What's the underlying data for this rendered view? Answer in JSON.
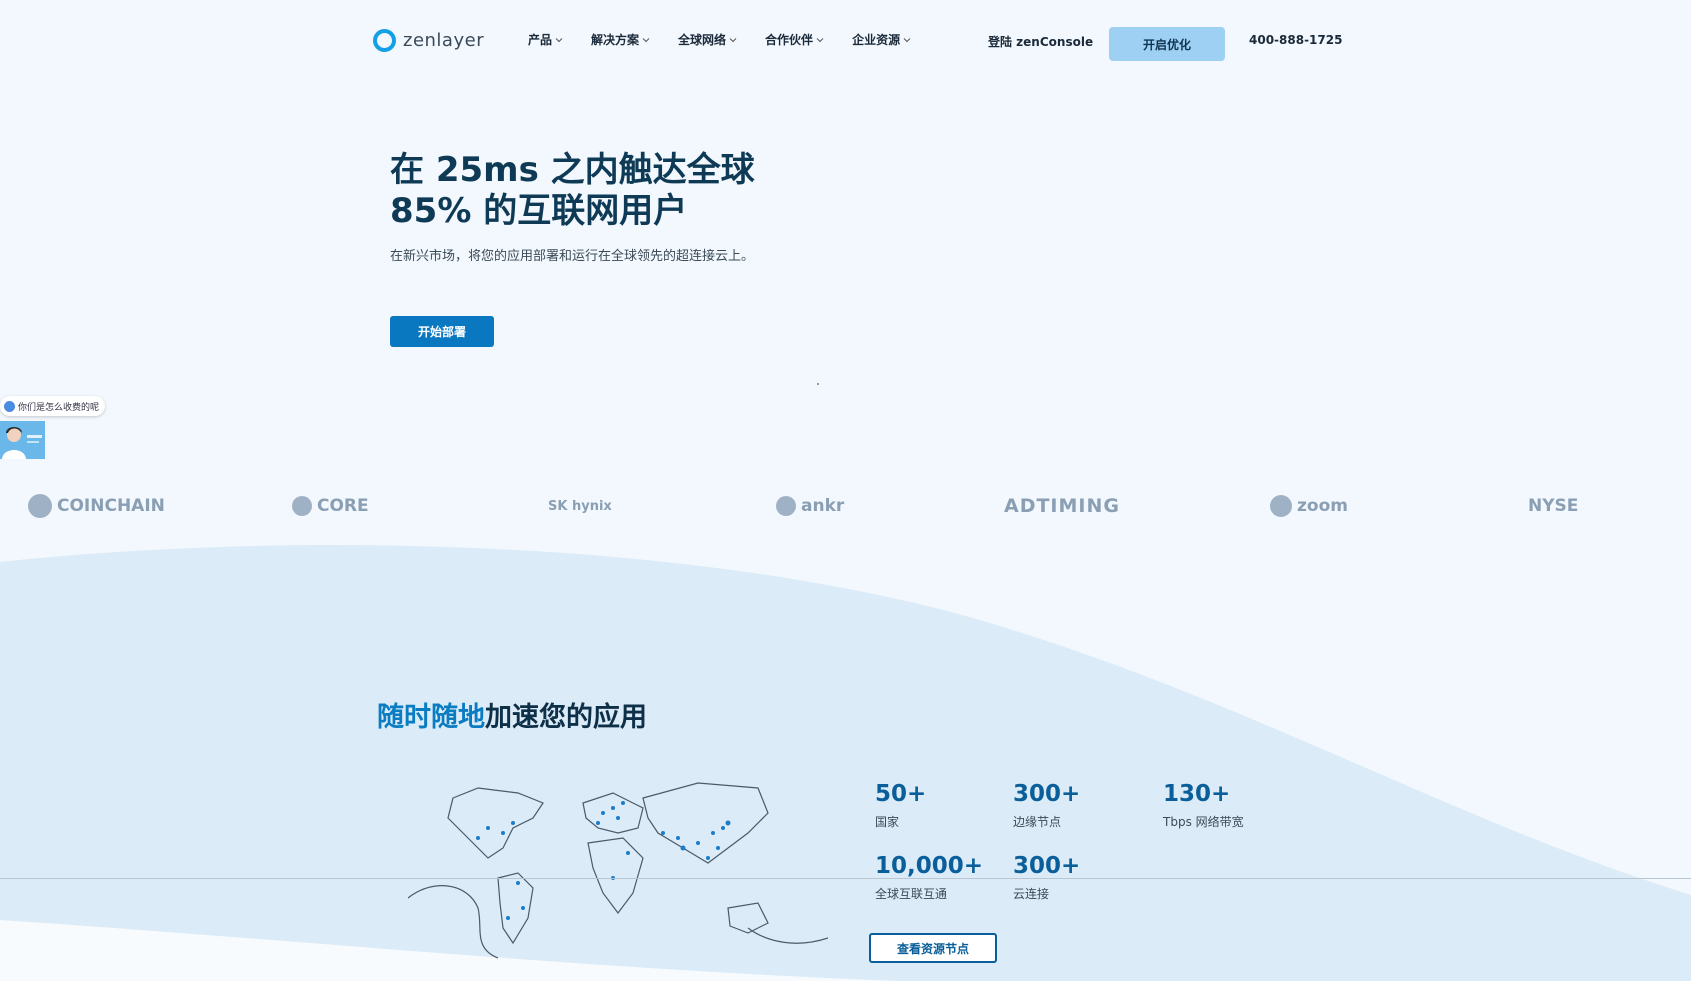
{
  "header": {
    "logo_text": "zenlayer",
    "nav": [
      {
        "label": "产品"
      },
      {
        "label": "解决方案"
      },
      {
        "label": "全球网络"
      },
      {
        "label": "合作伙伴"
      },
      {
        "label": "企业资源"
      }
    ],
    "login_label": "登陆 zenConsole",
    "cta_label": "开启优化",
    "phone": "400-888-1725"
  },
  "hero": {
    "title_line1": "在 25ms 之内触达全球",
    "title_line2": "85% 的互联网用户",
    "subtitle": "在新兴市场，将您的应用部署和运行在全球领先的超连接云上。",
    "button_label": "开始部署"
  },
  "chat": {
    "bubble_text": "你们是怎么收费的呢"
  },
  "logos": [
    "COINCHAIN",
    "CORE",
    "SK hynix",
    "ankr",
    "ADTIMING",
    "zoom",
    "NYSE"
  ],
  "section": {
    "title_highlight": "随时随地",
    "title_rest": "加速您的应用",
    "stats": [
      {
        "value": "50+",
        "label": "国家"
      },
      {
        "value": "300+",
        "label": "边缘节点"
      },
      {
        "value": "130+",
        "label": "Tbps 网络带宽"
      },
      {
        "value": "10,000+",
        "label": "全球互联互通"
      },
      {
        "value": "300+",
        "label": "云连接"
      }
    ],
    "button_label": "查看资源节点"
  },
  "colors": {
    "accent": "#0a78c0",
    "title_highlight": "#0a7cc2",
    "cta_light": "#9dd0f2",
    "background": "#f2f8fd"
  }
}
